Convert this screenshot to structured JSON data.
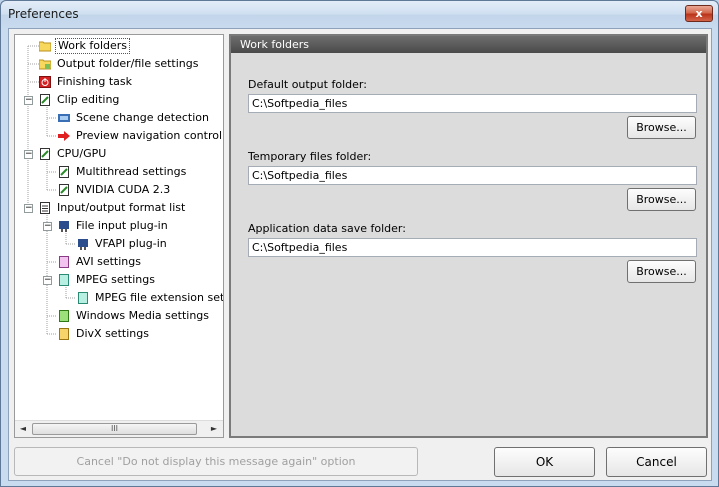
{
  "window": {
    "title": "Preferences",
    "close_glyph": "x"
  },
  "tree": {
    "items": [
      {
        "label": "Work folders",
        "icon": "folder-icon"
      },
      {
        "label": "Output folder/file settings",
        "icon": "folder-settings-icon"
      },
      {
        "label": "Finishing task",
        "icon": "power-icon"
      },
      {
        "label": "Clip editing",
        "icon": "edit-document-icon"
      },
      {
        "label": "Scene change detection",
        "icon": "film-strip-icon"
      },
      {
        "label": "Preview navigation control",
        "icon": "red-arrow-icon"
      },
      {
        "label": "CPU/GPU",
        "icon": "edit-document-icon"
      },
      {
        "label": "Multithread settings",
        "icon": "edit-document-icon"
      },
      {
        "label": "NVIDIA CUDA 2.3",
        "icon": "edit-document-icon"
      },
      {
        "label": "Input/output format list",
        "icon": "list-icon"
      },
      {
        "label": "File input plug-in",
        "icon": "plugin-icon"
      },
      {
        "label": "VFAPI plug-in",
        "icon": "plugin-icon"
      },
      {
        "label": "AVI settings",
        "icon": "avi-file-icon"
      },
      {
        "label": "MPEG settings",
        "icon": "mpeg-file-icon"
      },
      {
        "label": "MPEG file extension setting",
        "icon": "mpeg-file-icon"
      },
      {
        "label": "Windows Media settings",
        "icon": "wmv-file-icon"
      },
      {
        "label": "DivX settings",
        "icon": "divx-file-icon"
      }
    ],
    "scroll_left": "◄",
    "scroll_right": "►",
    "scroll_grip": "III"
  },
  "panel": {
    "header": "Work folders",
    "fields": [
      {
        "label": "Default output folder:",
        "value": "C:\\Softpedia_files",
        "button": "Browse..."
      },
      {
        "label": "Temporary files folder:",
        "value": "C:\\Softpedia_files",
        "button": "Browse..."
      },
      {
        "label": "Application data save folder:",
        "value": "C:\\Softpedia_files",
        "button": "Browse..."
      }
    ]
  },
  "footer": {
    "cancel_message": "Cancel \"Do not display this message again\" option",
    "ok": "OK",
    "cancel": "Cancel"
  }
}
